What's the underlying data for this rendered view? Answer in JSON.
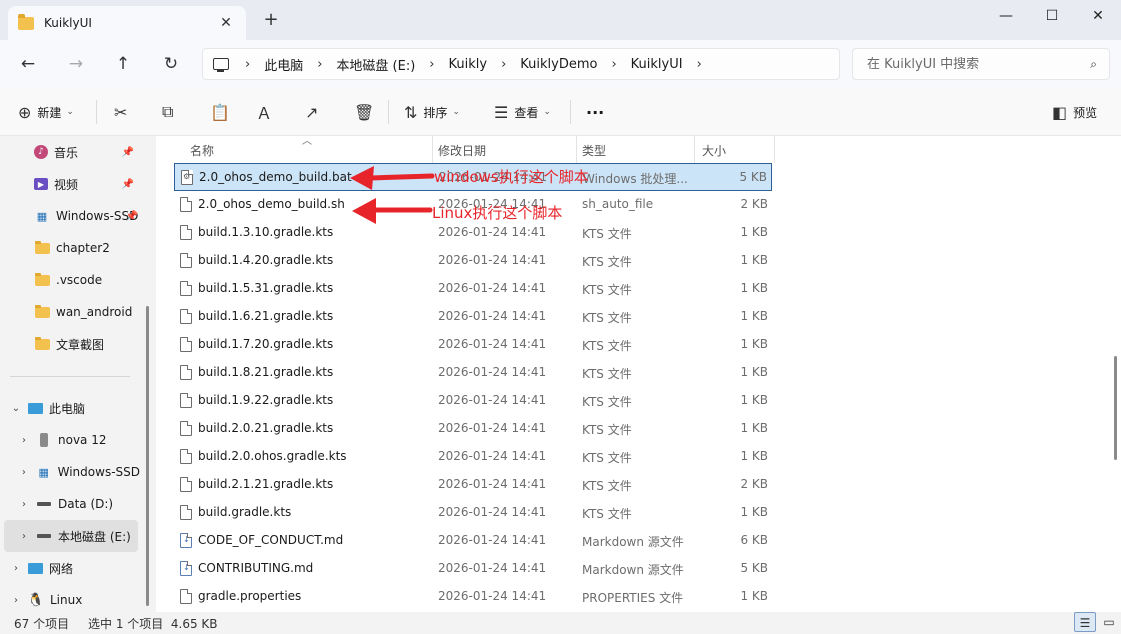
{
  "window": {
    "tab_title": "KuiklyUI",
    "new_tab": "+",
    "close_tab": "✕",
    "minimize": "—",
    "maximize": "☐",
    "close": "✕"
  },
  "nav": {
    "back": "←",
    "forward": "→",
    "up": "↑",
    "refresh": "↻",
    "breadcrumbs": [
      "此电脑",
      "本地磁盘 (E:)",
      "Kuikly",
      "KuiklyDemo",
      "KuiklyUI"
    ],
    "search_placeholder": "在 KuiklyUI 中搜索"
  },
  "commands": {
    "new_label": "新建",
    "sort_label": "排序",
    "view_label": "查看",
    "more": "···",
    "preview_label": "预览"
  },
  "sidebar": {
    "quick_access": [
      {
        "label": "音乐",
        "icon": "music-icon",
        "pinned": true
      },
      {
        "label": "视频",
        "icon": "video-icon",
        "pinned": true
      },
      {
        "label": "Windows-SSD",
        "icon": "windows-icon",
        "pinned": true
      },
      {
        "label": "chapter2",
        "icon": "folder-icon",
        "pinned": false
      },
      {
        "label": ".vscode",
        "icon": "folder-icon",
        "pinned": false
      },
      {
        "label": "wan_android",
        "icon": "folder-icon",
        "pinned": false
      },
      {
        "label": "文章截图",
        "icon": "folder-icon",
        "pinned": false
      }
    ],
    "this_pc": "此电脑",
    "drives": [
      {
        "label": "nova 12",
        "icon": "phone-icon"
      },
      {
        "label": "Windows-SSD",
        "icon": "windows-icon"
      },
      {
        "label": "Data (D:)",
        "icon": "drive-icon"
      },
      {
        "label": "本地磁盘 (E:)",
        "icon": "drive-icon",
        "selected": true
      }
    ],
    "network": "网络",
    "linux": "Linux"
  },
  "columns": {
    "name": "名称",
    "date": "修改日期",
    "type": "类型",
    "size": "大小"
  },
  "files": [
    {
      "name": "2.0_ohos_demo_build.bat",
      "date": "2026-01-24 14:41",
      "type": "Windows 批处理...",
      "size": "5 KB",
      "icon": "bat",
      "selected": true
    },
    {
      "name": "2.0_ohos_demo_build.sh",
      "date": "2026-01-24 14:41",
      "type": "sh_auto_file",
      "size": "2 KB",
      "icon": "file"
    },
    {
      "name": "build.1.3.10.gradle.kts",
      "date": "2026-01-24 14:41",
      "type": "KTS 文件",
      "size": "1 KB",
      "icon": "file"
    },
    {
      "name": "build.1.4.20.gradle.kts",
      "date": "2026-01-24 14:41",
      "type": "KTS 文件",
      "size": "1 KB",
      "icon": "file"
    },
    {
      "name": "build.1.5.31.gradle.kts",
      "date": "2026-01-24 14:41",
      "type": "KTS 文件",
      "size": "1 KB",
      "icon": "file"
    },
    {
      "name": "build.1.6.21.gradle.kts",
      "date": "2026-01-24 14:41",
      "type": "KTS 文件",
      "size": "1 KB",
      "icon": "file"
    },
    {
      "name": "build.1.7.20.gradle.kts",
      "date": "2026-01-24 14:41",
      "type": "KTS 文件",
      "size": "1 KB",
      "icon": "file"
    },
    {
      "name": "build.1.8.21.gradle.kts",
      "date": "2026-01-24 14:41",
      "type": "KTS 文件",
      "size": "1 KB",
      "icon": "file"
    },
    {
      "name": "build.1.9.22.gradle.kts",
      "date": "2026-01-24 14:41",
      "type": "KTS 文件",
      "size": "1 KB",
      "icon": "file"
    },
    {
      "name": "build.2.0.21.gradle.kts",
      "date": "2026-01-24 14:41",
      "type": "KTS 文件",
      "size": "1 KB",
      "icon": "file"
    },
    {
      "name": "build.2.0.ohos.gradle.kts",
      "date": "2026-01-24 14:41",
      "type": "KTS 文件",
      "size": "1 KB",
      "icon": "file"
    },
    {
      "name": "build.2.1.21.gradle.kts",
      "date": "2026-01-24 14:41",
      "type": "KTS 文件",
      "size": "2 KB",
      "icon": "file"
    },
    {
      "name": "build.gradle.kts",
      "date": "2026-01-24 14:41",
      "type": "KTS 文件",
      "size": "1 KB",
      "icon": "file"
    },
    {
      "name": "CODE_OF_CONDUCT.md",
      "date": "2026-01-24 14:41",
      "type": "Markdown 源文件",
      "size": "6 KB",
      "icon": "md"
    },
    {
      "name": "CONTRIBUTING.md",
      "date": "2026-01-24 14:41",
      "type": "Markdown 源文件",
      "size": "5 KB",
      "icon": "md"
    },
    {
      "name": "gradle.properties",
      "date": "2026-01-24 14:41",
      "type": "PROPERTIES 文件",
      "size": "1 KB",
      "icon": "file"
    }
  ],
  "annotations": {
    "windows": "windows执行这个脚本",
    "linux": "Linux执行这个脚本",
    "arrow_color": "#e8242b"
  },
  "status": {
    "count": "67 个项目",
    "selection": "选中 1 个项目  4.65 KB"
  },
  "colors": {
    "selection_bg": "#cce4f7",
    "selection_border": "#2f5f97",
    "folder": "#f2c14e"
  }
}
